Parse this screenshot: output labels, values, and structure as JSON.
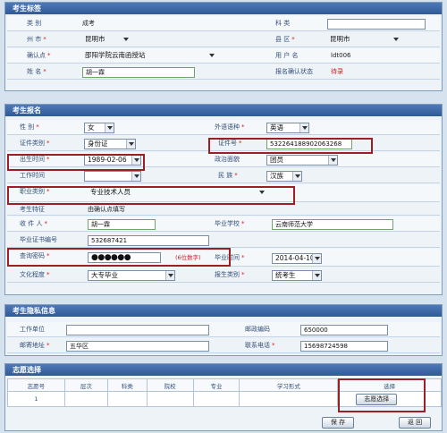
{
  "tag_section": {
    "title": "考生标签",
    "category_label": "类 别",
    "category_value": "成考",
    "subject_label": "科 类",
    "city_label": "州 市",
    "city_value": "昆明市",
    "county_label": "县 区",
    "county_value": "昆明市",
    "confirm_point_label": "确认点",
    "confirm_point_value": "邵阳学院云南函授站",
    "username_label": "用 户 名",
    "username_value": "ldt006",
    "name_label": "姓 名",
    "name_value": "胡一霖",
    "status_label": "报名确认状态",
    "status_value": "待录"
  },
  "signup_section": {
    "title": "考生报名",
    "gender_label": "性 别",
    "gender_value": "女",
    "foreign_lang_label": "外语语种",
    "foreign_lang_value": "英语",
    "id_type_label": "证件类别",
    "id_type_value": "身份证",
    "id_no_label": "证件号",
    "id_no_value": "532264188902063268",
    "birth_label": "出生时间",
    "birth_value": "1989-02-06",
    "politics_label": "政治面貌",
    "politics_value": "团员",
    "work_time_label": "工作时间",
    "ethnic_label": "民 族",
    "ethnic_value": "汉族",
    "occupation_label": "职业类别",
    "occupation_value": "专业技术人员",
    "feature_label": "考生特征",
    "feature_value": "由确认点填写",
    "recipient_label": "收 件 人",
    "recipient_value": "胡一霖",
    "school_label": "毕业学校",
    "school_value": "云南师范大学",
    "cert_no_label": "毕业证书编号",
    "cert_no_value": "532687421",
    "password_label": "查询密码",
    "password_value": "●●●●●●",
    "password_hint": "(6位数字)",
    "grad_time_label": "毕业时间",
    "grad_time_value": "2014-04-10",
    "education_label": "文化程度",
    "education_value": "大专毕业",
    "applicant_type_label": "报生类别",
    "applicant_type_value": "统考生"
  },
  "private_section": {
    "title": "考生隐私信息",
    "work_unit_label": "工作单位",
    "postcode_label": "邮政编码",
    "postcode_value": "650000",
    "address_label": "邮寄地址",
    "address_value": "五华区",
    "phone_label": "联系电话",
    "phone_value": "15698724598"
  },
  "volunteer_section": {
    "title": "志愿选择",
    "columns": [
      "志愿号",
      "层次",
      "科类",
      "院校",
      "专业",
      "学习形式",
      "选择"
    ],
    "row_no": "1",
    "choose_button": "志愿选择",
    "save_button": "保 存",
    "back_button": "返 回"
  }
}
